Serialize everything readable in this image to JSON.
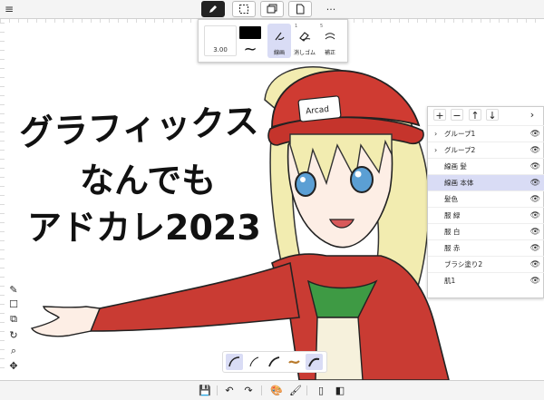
{
  "top_toolbar": {
    "menu_icon": "hamburger-icon",
    "tools": [
      {
        "icon": "pen-icon",
        "active": true
      },
      {
        "icon": "marquee-select-icon",
        "active": false
      },
      {
        "icon": "layers-copy-icon",
        "active": false
      },
      {
        "icon": "document-icon",
        "active": false
      }
    ],
    "more_label": "···"
  },
  "brush_popup": {
    "size_value": "3.00",
    "color": "#000000",
    "brushes": [
      {
        "num": "",
        "label": "線画",
        "selected": true
      },
      {
        "num": "1",
        "label": "消しゴム",
        "selected": false
      },
      {
        "num": "5",
        "label": "補正",
        "selected": false
      }
    ]
  },
  "canvas": {
    "title_text": [
      "グラフィックス",
      "なんでも",
      "アドカレ2023"
    ],
    "cap_badge": "Arcad"
  },
  "layers_panel": {
    "header_buttons": [
      "+",
      "−",
      "↑",
      "↓"
    ],
    "expand_label": "›",
    "layers": [
      {
        "name": "グループ1",
        "group": true,
        "selected": false
      },
      {
        "name": "グループ2",
        "group": true,
        "selected": false
      },
      {
        "name": "線画 髪",
        "group": false,
        "selected": false
      },
      {
        "name": "線画 本体",
        "group": false,
        "selected": true
      },
      {
        "name": "髪色",
        "group": false,
        "selected": false
      },
      {
        "name": "服 緑",
        "group": false,
        "selected": false
      },
      {
        "name": "服 白",
        "group": false,
        "selected": false
      },
      {
        "name": "服 赤",
        "group": false,
        "selected": false
      },
      {
        "name": "ブラシ塗り2",
        "group": false,
        "selected": false
      },
      {
        "name": "肌1",
        "group": false,
        "selected": false
      }
    ],
    "eye_glyph": "👁"
  },
  "left_tools": {
    "glyphs": [
      "✎",
      "☐",
      "⧉",
      "↻",
      "⌕",
      "✥"
    ]
  },
  "bottom_toolbar": {
    "glyphs": [
      "💾",
      "↶",
      "↷",
      "🎨",
      "🖌",
      "▯",
      "◧"
    ]
  }
}
